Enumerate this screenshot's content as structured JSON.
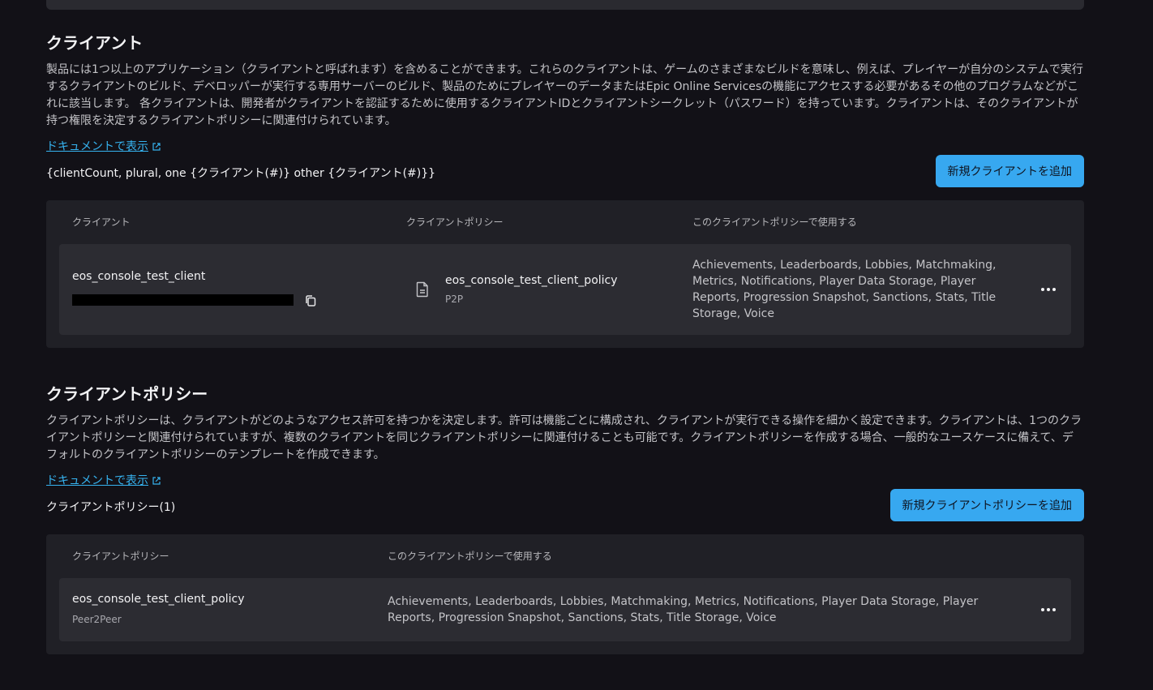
{
  "clients_section": {
    "title": "クライアント",
    "description": "製品には1つ以上のアプリケーション（クライアントと呼ばれます）を含めることができます。これらのクライアントは、ゲームのさまざまなビルドを意味し、例えば、プレイヤーが自分のシステムで実行するクライアントのビルド、デベロッパーが実行する専用サーバーのビルド、製品のためにプレイヤーのデータまたはEpic Online Servicesの機能にアクセスする必要があるその他のプログラムなどがこれに該当します。 各クライアントは、開発者がクライアントを認証するために使用するクライアントIDとクライアントシークレット（パスワード）を持っています。クライアントは、そのクライアントが持つ権限を決定するクライアントポリシーに関連付けられています。",
    "doc_link": "ドキュメントで表示",
    "count_label": "{clientCount, plural, one {クライアント(#)} other {クライアント(#)}}",
    "add_button": "新規クライアントを追加",
    "table": {
      "headers": {
        "client": "クライアント",
        "policy": "クライアントポリシー",
        "features": "このクライアントポリシーで使用する"
      },
      "rows": [
        {
          "client_name": "eos_console_test_client",
          "policy_name": "eos_console_test_client_policy",
          "policy_type": "P2P",
          "features": "Achievements, Leaderboards, Lobbies, Matchmaking, Metrics, Notifications, Player Data Storage, Player Reports, Progression Snapshot, Sanctions, Stats, Title Storage, Voice"
        }
      ]
    }
  },
  "policies_section": {
    "title": "クライアントポリシー",
    "description": "クライアントポリシーは、クライアントがどのようなアクセス許可を持つかを決定します。許可は機能ごとに構成され、クライアントが実行できる操作を細かく設定できます。クライアントは、1つのクライアントポリシーと関連付けられていますが、複数のクライアントを同じクライアントポリシーに関連付けることも可能です。クライアントポリシーを作成する場合、一般的なユースケースに備えて、デフォルトのクライアントポリシーのテンプレートを作成できます。",
    "doc_link": "ドキュメントで表示",
    "count_label": "クライアントポリシー(1)",
    "add_button": "新規クライアントポリシーを追加",
    "table": {
      "headers": {
        "policy": "クライアントポリシー",
        "features": "このクライアントポリシーで使用する"
      },
      "rows": [
        {
          "policy_name": "eos_console_test_client_policy",
          "policy_type": "Peer2Peer",
          "features": "Achievements, Leaderboards, Lobbies, Matchmaking, Metrics, Notifications, Player Data Storage, Player Reports, Progression Snapshot, Sanctions, Stats, Title Storage, Voice"
        }
      ]
    }
  },
  "icons": {
    "external_link": "external-link-icon",
    "copy": "copy-icon",
    "document": "document-icon",
    "more": "more-horizontal-icon"
  },
  "colors": {
    "background": "#121117",
    "panel": "#202026",
    "row": "#2c2c32",
    "accent": "#37a8f0",
    "link": "#36b3f0"
  }
}
